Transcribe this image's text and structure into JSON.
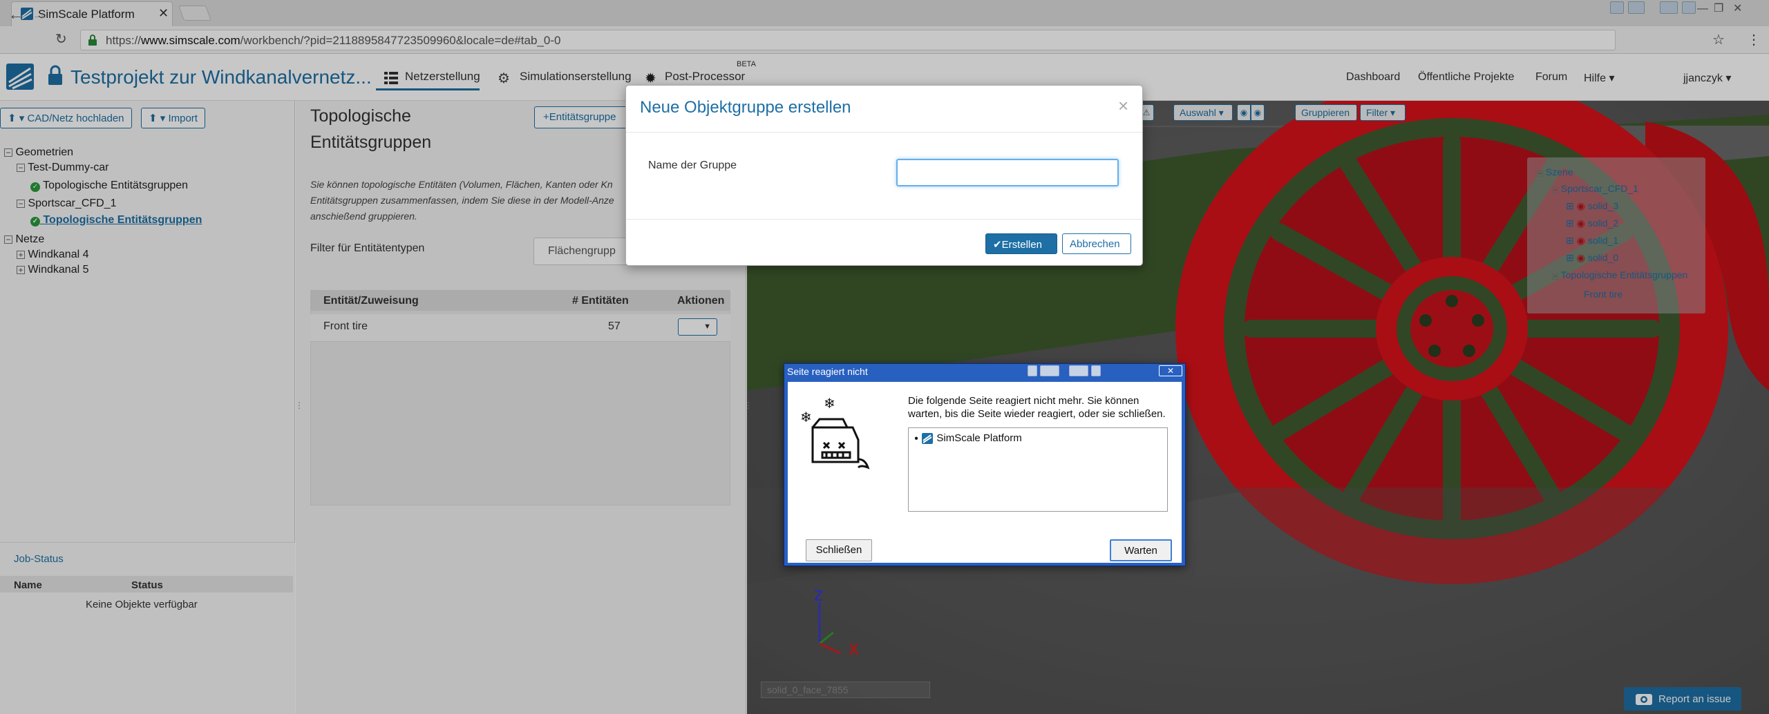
{
  "browser": {
    "tab_title": "SimScale Platform",
    "tab_close": "✕",
    "url_prefix": "https://",
    "url_host": "www.simscale.com",
    "url_rest": "/workbench/?pid=2118895847723509960&locale=de#tab_0-0"
  },
  "header": {
    "project_title": "Testprojekt zur Windkanalvernetz...",
    "tabs": [
      "Netzerstellung",
      "Simulationserstellung",
      "Post-Processor"
    ],
    "beta_badge": "BETA",
    "links": [
      "Dashboard",
      "Öffentliche Projekte",
      "Forum",
      "Hilfe"
    ],
    "user": "jjanczyk"
  },
  "left_panel": {
    "upload_btn": "CAD/Netz hochladen",
    "import_btn": "Import",
    "tree": {
      "geometries": "Geometrien",
      "dummy_car": "Test-Dummy-car",
      "dummy_groups": "Topologische Entitätsgruppen",
      "sportscar": "Sportscar_CFD_1",
      "sportscar_groups": "Topologische Entitätsgruppen",
      "meshes": "Netze",
      "tunnel4": "Windkanal 4",
      "tunnel5": "Windkanal 5"
    },
    "job_status": {
      "title": "Job-Status",
      "col_name": "Name",
      "col_status": "Status",
      "empty": "Keine Objekte verfügbar"
    }
  },
  "middle_panel": {
    "title_line1": "Topologische",
    "title_line2": "Entitätsgruppen",
    "add_group_btn": "Entitätsgruppe",
    "desc_line1": "Sie können topologische Entitäten (Volumen, Flächen, Kanten oder Kn",
    "desc_line2": "Entitätsgruppen zusammenfassen, indem Sie diese in der Modell-Anze",
    "desc_line3": "anschießend gruppieren.",
    "filter_label": "Filter für Entitätentypen",
    "filter_value": "Flächengrupp",
    "table": {
      "col_entity": "Entität/Zuweisung",
      "col_count": "# Entitäten",
      "col_actions": "Aktionen",
      "rows": [
        {
          "name": "Front tire",
          "count": "57"
        }
      ]
    }
  },
  "viewport": {
    "toolbar": {
      "selection": "Auswahl",
      "group": "Gruppieren",
      "filter": "Filter"
    },
    "scene_tree": {
      "root": "Szene",
      "model": "Sportscar_CFD_1",
      "solids": [
        "solid_3",
        "solid_2",
        "solid_1",
        "solid_0"
      ],
      "groups": "Topologische Entitätsgruppen",
      "group_item": "Front tire"
    },
    "face_label": "solid_0_face_7855",
    "axis_z": "Z",
    "axis_x": "X",
    "report_btn": "Report an issue"
  },
  "modal": {
    "title": "Neue Objektgruppe erstellen",
    "close": "×",
    "field_label": "Name der Gruppe",
    "field_value": "",
    "create_btn": "Erstellen",
    "cancel_btn": "Abbrechen"
  },
  "hang_dialog": {
    "title": "Seite reagiert nicht",
    "message_line1": "Die folgende Seite reagiert nicht mehr. Sie können",
    "message_line2": "warten, bis die Seite wieder reagiert, oder sie schließen.",
    "page_item": "SimScale Platform",
    "close_btn": "Schließen",
    "wait_btn": "Warten"
  },
  "colors": {
    "brand_blue": "#1d6fa5",
    "tire_red": "#d9121b",
    "rim_green": "#3f5a30"
  }
}
